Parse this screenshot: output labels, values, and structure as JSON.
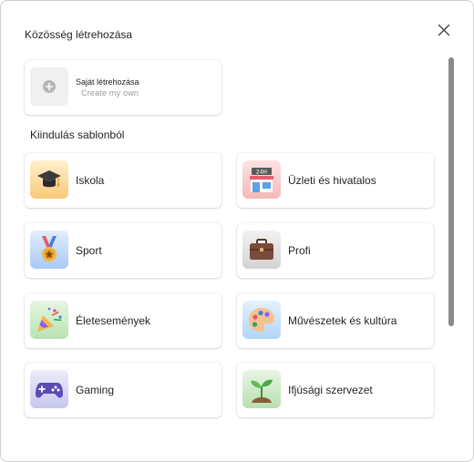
{
  "dialog": {
    "title": "Közösség létrehozása",
    "close_icon": "close-icon"
  },
  "create_own": {
    "label": "Saját létrehozása",
    "ghost_text": "Create my own",
    "icon": "add-icon"
  },
  "templates": {
    "section_label": "Kiindulás sablonból",
    "items": [
      {
        "label": "Iskola",
        "icon": "graduation-cap-icon",
        "tile_color": "#fde7b8"
      },
      {
        "label": "Üzleti és hivatalos",
        "icon": "storefront-icon",
        "tile_color": "#f9d3d3"
      },
      {
        "label": "Sport",
        "icon": "medal-icon",
        "tile_color": "#cfe1fb"
      },
      {
        "label": "Profi",
        "icon": "briefcase-icon",
        "tile_color": "#e5e5e5"
      },
      {
        "label": "Életesemények",
        "icon": "party-popper-icon",
        "tile_color": "#d5efd0"
      },
      {
        "label": "Művészetek és kultúra",
        "icon": "palette-icon",
        "tile_color": "#d4e8fb"
      },
      {
        "label": "Gaming",
        "icon": "game-controller-icon",
        "tile_color": "#e1e1f6"
      },
      {
        "label": "Ifjúsági szervezet",
        "icon": "sprout-icon",
        "tile_color": "#d7efd3"
      }
    ]
  }
}
